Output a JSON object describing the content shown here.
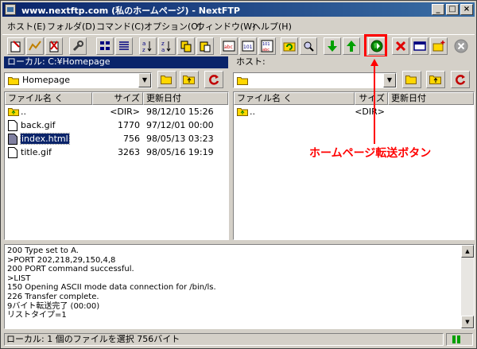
{
  "window": {
    "title": "www.nextftp.com (私のホームページ) - NextFTP",
    "minimize": "_",
    "maximize": "□",
    "close": "×"
  },
  "menu": [
    {
      "label": "ホスト(E)"
    },
    {
      "label": "フォルダ(D)"
    },
    {
      "label": "コマンド(C)"
    },
    {
      "label": "オプション(O)"
    },
    {
      "label": "ウィンドウ(W)"
    },
    {
      "label": "ヘルプ(H)"
    }
  ],
  "local": {
    "header": "ローカル: C:¥Homepage",
    "path": "Homepage",
    "columns": {
      "name": "ファイル名 く",
      "size": "サイズ",
      "date": "更新日付"
    },
    "files": [
      {
        "name": "..",
        "size": "<DIR>",
        "date": "98/12/10 15:26",
        "icon": "parent-folder-icon"
      },
      {
        "name": "back.gif",
        "size": "1770",
        "date": "97/12/01 00:00",
        "icon": "file-icon"
      },
      {
        "name": "index.html",
        "size": "756",
        "date": "98/05/13 03:23",
        "icon": "file-icon",
        "selected": true
      },
      {
        "name": "title.gif",
        "size": "3263",
        "date": "98/05/16 19:19",
        "icon": "file-icon"
      }
    ]
  },
  "remote": {
    "header": "ホスト:",
    "path": "",
    "columns": {
      "name": "ファイル名 く",
      "size": "サイズ",
      "date": "更新日付"
    },
    "files": [
      {
        "name": "..",
        "size": "<DIR>",
        "date": "",
        "icon": "parent-folder-icon"
      }
    ]
  },
  "log": [
    "200 Type set to A.",
    ">PORT 202,218,29,150,4,8",
    "200 PORT command successful.",
    ">LIST",
    "150 Opening ASCII mode data connection for /bin/ls.",
    "226 Transfer complete.",
    "9バイト転送完了 (00:00)",
    "リストタイプ=1"
  ],
  "status": {
    "text": "ローカル: 1 個のファイルを選択   756バイト"
  },
  "annotation": {
    "text": "ホームページ転送ボタン",
    "color": "#ff0000"
  },
  "colors": {
    "title_bar": "#0a246a",
    "face": "#d4d0c8",
    "highlight": "#ff0000"
  }
}
